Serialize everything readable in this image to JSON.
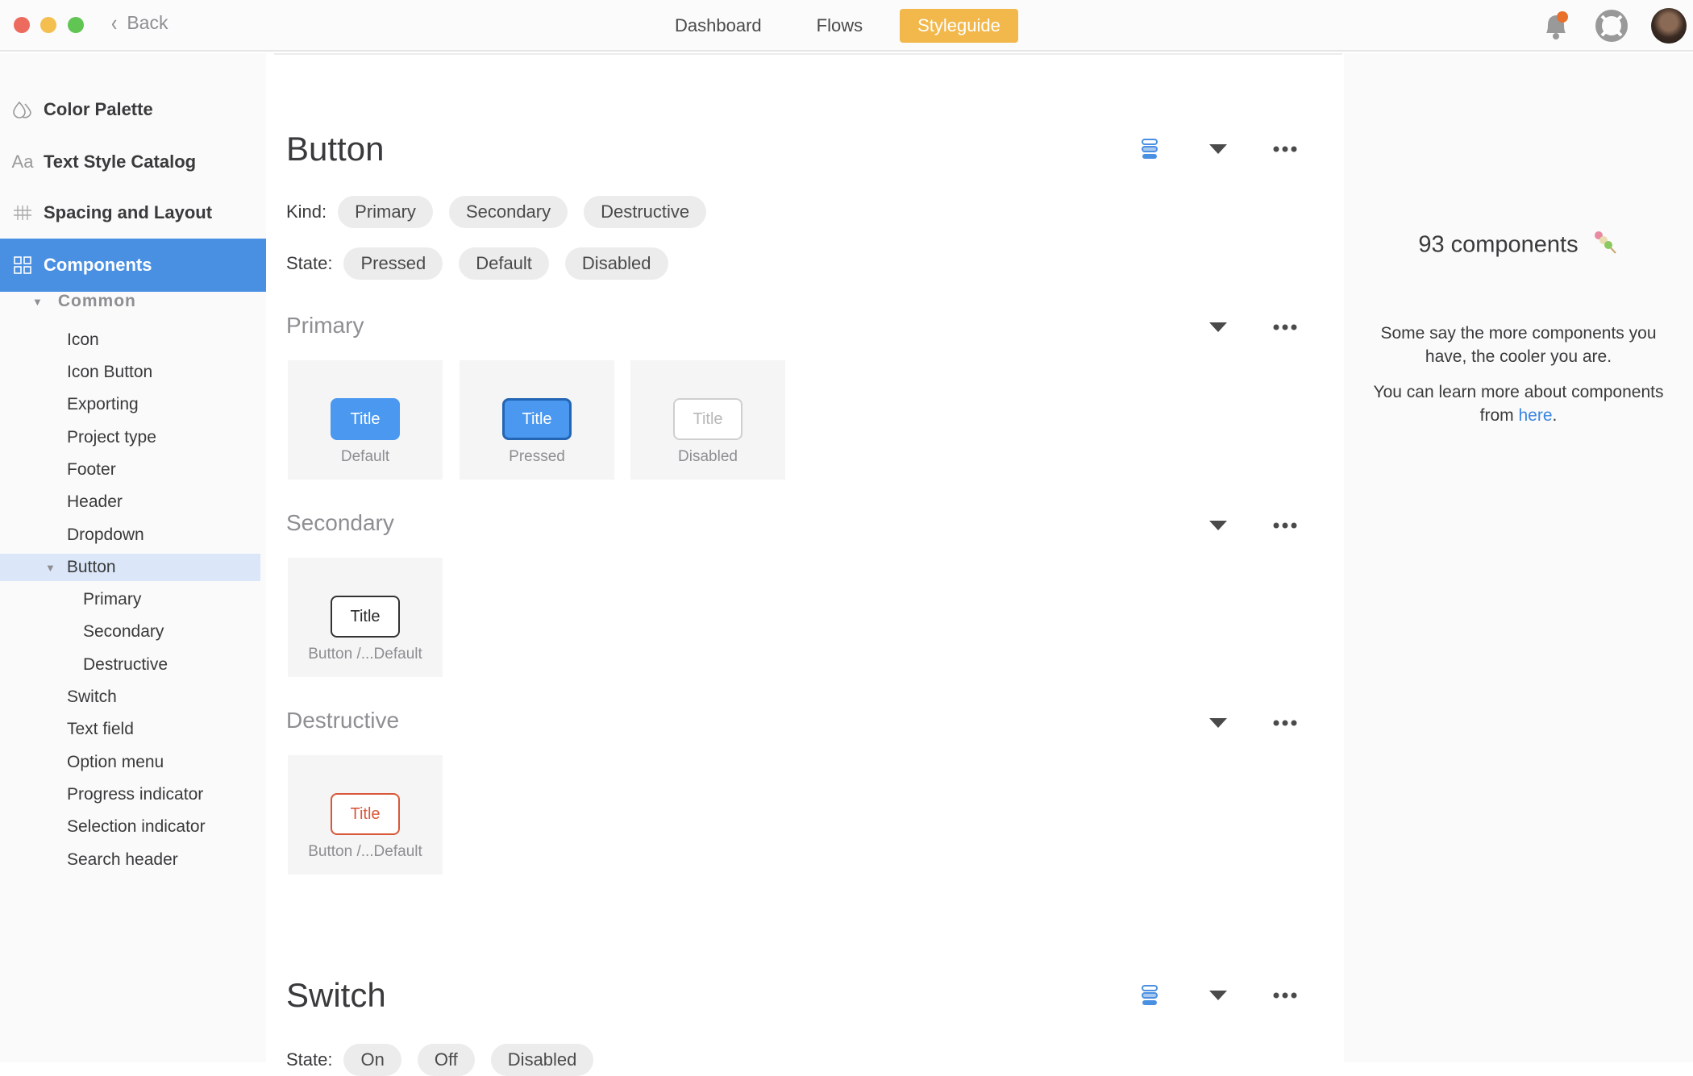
{
  "window": {
    "back_label": "Back"
  },
  "nav": {
    "items": [
      {
        "label": "Dashboard",
        "active": false
      },
      {
        "label": "Flows",
        "active": false
      },
      {
        "label": "Styleguide",
        "active": true
      }
    ],
    "accent_color": "#f2b84b"
  },
  "top_icons": {
    "notifications": "bell-icon",
    "help": "lifebuoy-icon",
    "profile": "avatar"
  },
  "sidebar": {
    "sections": [
      {
        "label": "Color Palette",
        "icon": "droplets-icon"
      },
      {
        "label": "Text Style Catalog",
        "icon": "text-style-icon",
        "glyph": "Aa"
      },
      {
        "label": "Spacing and Layout",
        "icon": "grid-lines-icon"
      },
      {
        "label": "Components",
        "icon": "components-grid-icon",
        "active": true
      }
    ],
    "group_label": "Common",
    "items": [
      "Icon",
      "Icon Button",
      "Exporting",
      "Project type",
      "Footer",
      "Header",
      "Dropdown",
      "Button"
    ],
    "button_children": [
      "Primary",
      "Secondary",
      "Destructive"
    ],
    "items_after": [
      "Switch",
      "Text field",
      "Option menu",
      "Progress indicator",
      "Selection indicator",
      "Search header"
    ],
    "selected": "Button",
    "active_color": "#4a90e2"
  },
  "main": {
    "button_section": {
      "title": "Button",
      "kind_label": "Kind:",
      "kinds": [
        "Primary",
        "Secondary",
        "Destructive"
      ],
      "state_label": "State:",
      "states": [
        "Pressed",
        "Default",
        "Disabled"
      ],
      "subsections": {
        "primary": {
          "title": "Primary",
          "cards": [
            {
              "button_label": "Title",
              "caption": "Default"
            },
            {
              "button_label": "Title",
              "caption": "Pressed"
            },
            {
              "button_label": "Title",
              "caption": "Disabled"
            }
          ]
        },
        "secondary": {
          "title": "Secondary",
          "cards": [
            {
              "button_label": "Title",
              "caption": "Button /...Default"
            }
          ]
        },
        "destructive": {
          "title": "Destructive",
          "cards": [
            {
              "button_label": "Title",
              "caption": "Button /...Default"
            }
          ]
        }
      }
    },
    "switch_section": {
      "title": "Switch",
      "state_label": "State:",
      "states": [
        "On",
        "Off",
        "Disabled"
      ]
    }
  },
  "right_panel": {
    "count_text": "93 components",
    "count_emoji": "dango-icon",
    "blurb1": "Some say the more components you have, the cooler you are.",
    "blurb2_prefix": "You can learn more about components from ",
    "blurb2_link": "here",
    "blurb2_suffix": ".",
    "link_color": "#3a86e0"
  }
}
